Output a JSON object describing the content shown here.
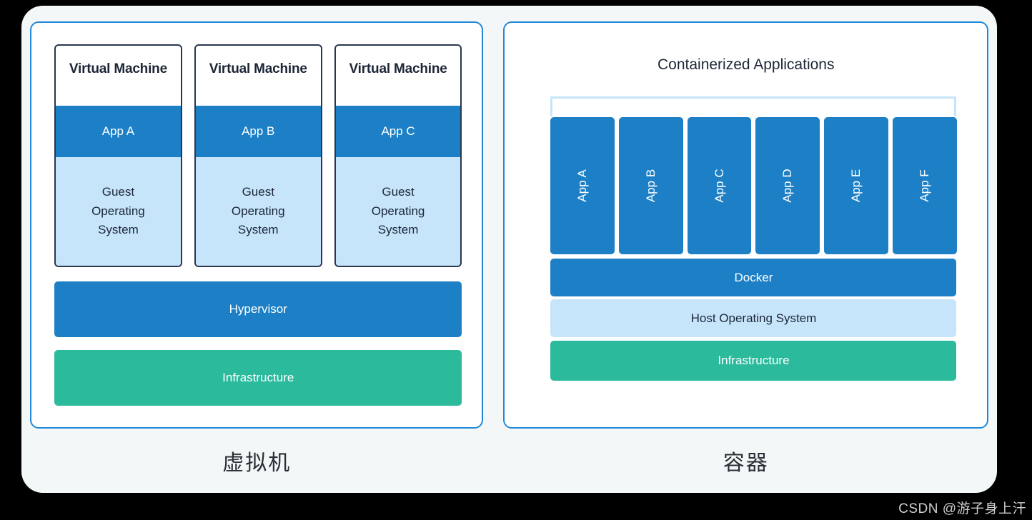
{
  "watermark": "CSDN @游子身上汗",
  "left_panel": {
    "caption": "虚拟机",
    "vms": [
      {
        "title": "Virtual Machine",
        "app": "App A",
        "guest_os": "Guest\nOperating\nSystem"
      },
      {
        "title": "Virtual Machine",
        "app": "App B",
        "guest_os": "Guest\nOperating\nSystem"
      },
      {
        "title": "Virtual Machine",
        "app": "App C",
        "guest_os": "Guest\nOperating\nSystem"
      }
    ],
    "hypervisor_label": "Hypervisor",
    "infrastructure_label": "Infrastructure"
  },
  "right_panel": {
    "caption": "容器",
    "heading": "Containerized Applications",
    "apps": [
      {
        "label": "App A"
      },
      {
        "label": "App B"
      },
      {
        "label": "App C"
      },
      {
        "label": "App D"
      },
      {
        "label": "App E"
      },
      {
        "label": "App F"
      }
    ],
    "docker_label": "Docker",
    "host_os_label": "Host Operating System",
    "infrastructure_label": "Infrastructure"
  },
  "colors": {
    "panel_border": "#2189d8",
    "vm_box_border": "#2b3750",
    "blue_fill": "#1d80c6",
    "light_blue_fill": "#c6e4fa",
    "green_fill": "#2bba9c",
    "card_background": "#f3f7f8",
    "page_background": "#000000",
    "dark_text": "#1d2637"
  }
}
